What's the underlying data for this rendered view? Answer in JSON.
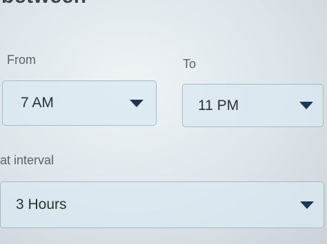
{
  "heading": "between",
  "from": {
    "label": "From",
    "value": "7 AM"
  },
  "to": {
    "label": "To",
    "value": "11 PM"
  },
  "interval": {
    "label": "at interval",
    "value": "3 Hours"
  },
  "icons": {
    "dropdown": "caret-down-icon"
  },
  "colors": {
    "caret": "#1d3556",
    "field_border": "#a9b9c4"
  }
}
